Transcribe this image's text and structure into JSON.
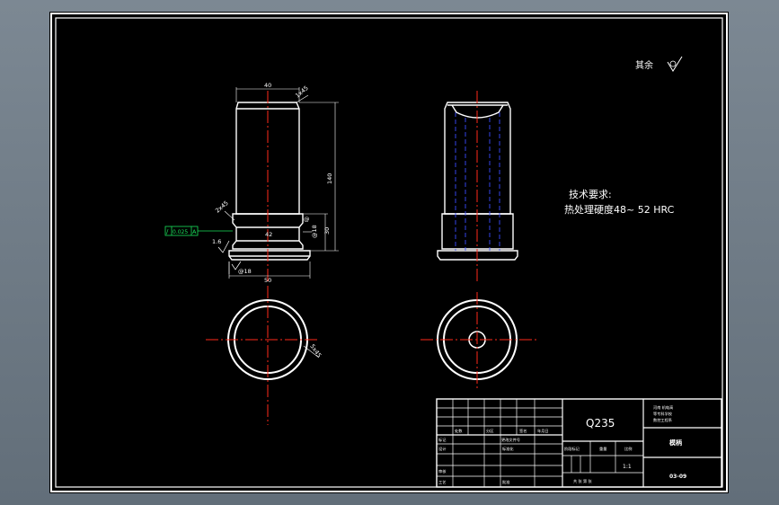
{
  "drawing": {
    "surface_note": {
      "label": "其余"
    },
    "dims": {
      "top_width": "40",
      "top_chamfer": "1x45",
      "height": "140",
      "right_small": "@",
      "ring_dia": "@18",
      "ring_height": "30",
      "inner_label": "42",
      "bottom_left": "@18",
      "bottom_width": "50",
      "chamfer_small": "2x45",
      "rough_mark": "1.6",
      "circle_note": "5x45"
    },
    "tolerance": {
      "symbol": "/",
      "value": "0.025",
      "datum": "A"
    },
    "tech_req": {
      "title": "技术要求:",
      "line1": "热处理硬度48~ 52 HRC"
    },
    "title_block": {
      "material": "Q235",
      "row_labels": [
        "标记",
        "处数",
        "分区",
        "更改文件号",
        "签名",
        "年月日"
      ],
      "design": "设计",
      "standard": "标准化",
      "review": "审核",
      "process": "工艺",
      "approve": "批准",
      "stage_mark": "阶段标记",
      "weight": "重量",
      "scale": "比例",
      "scale_value": "1:1",
      "sheet_info": "共 张 第 张",
      "school_line1": "河南 机电高",
      "school_line2": "等专科学校",
      "school_line3": "数控工程系",
      "part_name": "模柄",
      "drawing_no": "03-09"
    }
  },
  "colors": {
    "background": "#000000",
    "outline": "#ffffff",
    "centerline": "#ff2a1a",
    "hidden": "#3a4cff",
    "tolerance": "#19e05a",
    "frame": "#6c7883"
  }
}
